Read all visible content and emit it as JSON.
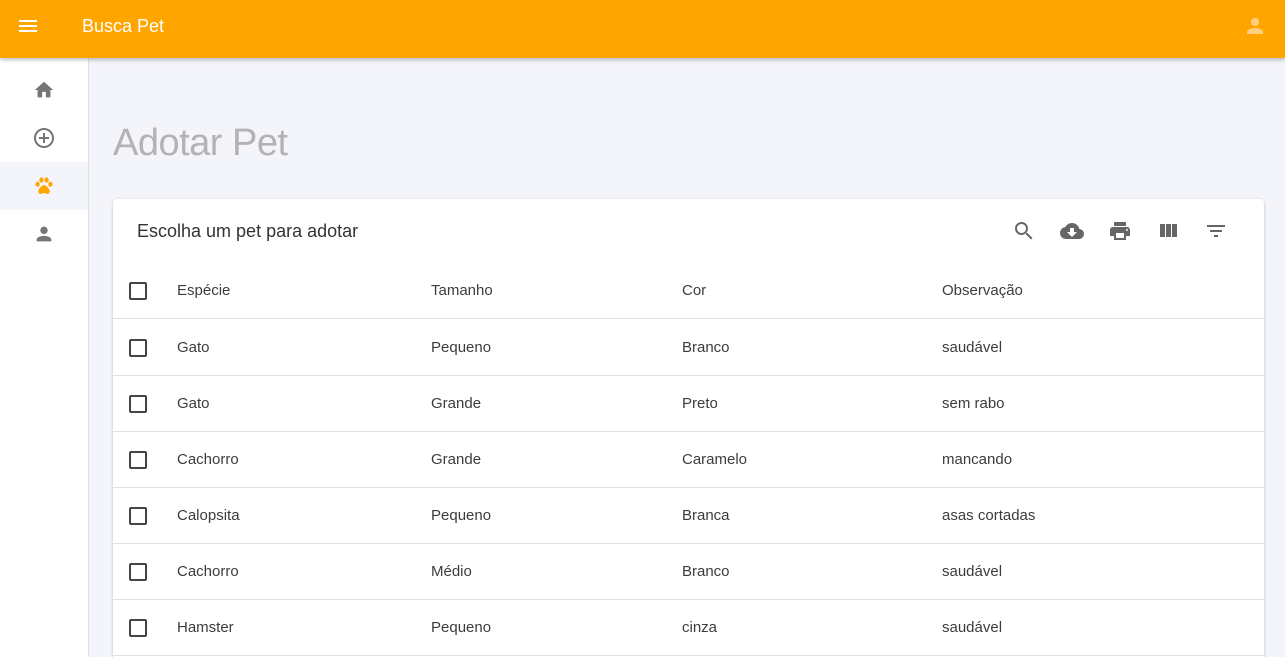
{
  "app": {
    "title": "Busca Pet"
  },
  "page": {
    "title": "Adotar Pet"
  },
  "table": {
    "title": "Escolha um pet para adotar",
    "columns": [
      "Espécie",
      "Tamanho",
      "Cor",
      "Observação"
    ],
    "rows": [
      [
        "Gato",
        "Pequeno",
        "Branco",
        "saudável"
      ],
      [
        "Gato",
        "Grande",
        "Preto",
        "sem rabo"
      ],
      [
        "Cachorro",
        "Grande",
        "Caramelo",
        "mancando"
      ],
      [
        "Calopsita",
        "Pequeno",
        "Branca",
        "asas cortadas"
      ],
      [
        "Cachorro",
        "Médio",
        "Branco",
        "saudável"
      ],
      [
        "Hamster",
        "Pequeno",
        "cinza",
        "saudável"
      ]
    ]
  },
  "sidebar": {
    "items": [
      {
        "icon": "home-icon",
        "active": false
      },
      {
        "icon": "add-circle-icon",
        "active": false
      },
      {
        "icon": "paw-icon",
        "active": true
      },
      {
        "icon": "person-icon",
        "active": false
      }
    ]
  },
  "toolbar": {
    "icons": [
      "search-icon",
      "download-icon",
      "print-icon",
      "columns-icon",
      "filter-icon"
    ]
  },
  "colors": {
    "accent": "#ffa500",
    "background": "#f4f5fa",
    "icon": "#757575",
    "active_icon": "#ffa500"
  }
}
